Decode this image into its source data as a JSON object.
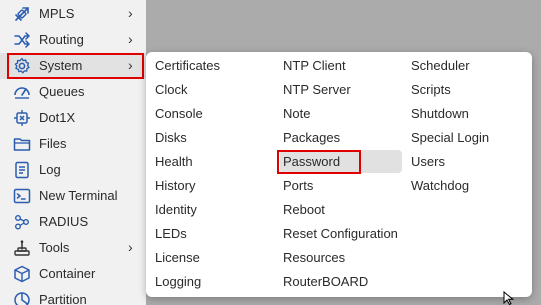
{
  "sidebar": {
    "items": [
      {
        "label": "MPLS",
        "icon": "mpls-icon",
        "has_submenu": true
      },
      {
        "label": "Routing",
        "icon": "routing-icon",
        "has_submenu": true
      },
      {
        "label": "System",
        "icon": "gear-icon",
        "has_submenu": true,
        "active": true
      },
      {
        "label": "Queues",
        "icon": "queues-icon",
        "has_submenu": false
      },
      {
        "label": "Dot1X",
        "icon": "dot1x-icon",
        "has_submenu": false
      },
      {
        "label": "Files",
        "icon": "folder-icon",
        "has_submenu": false
      },
      {
        "label": "Log",
        "icon": "log-icon",
        "has_submenu": false
      },
      {
        "label": "New Terminal",
        "icon": "terminal-icon",
        "has_submenu": false
      },
      {
        "label": "RADIUS",
        "icon": "radius-icon",
        "has_submenu": false
      },
      {
        "label": "Tools",
        "icon": "tools-icon",
        "has_submenu": true
      },
      {
        "label": "Container",
        "icon": "container-icon",
        "has_submenu": false
      },
      {
        "label": "Partition",
        "icon": "partition-icon",
        "has_submenu": false
      }
    ],
    "chevron": "›"
  },
  "submenu": {
    "columns": [
      [
        "Certificates",
        "Clock",
        "Console",
        "Disks",
        "Health",
        "History",
        "Identity",
        "LEDs",
        "License",
        "Logging"
      ],
      [
        "NTP Client",
        "NTP Server",
        "Note",
        "Packages",
        "Password",
        "Ports",
        "Reboot",
        "Reset Configuration",
        "Resources",
        "RouterBOARD"
      ],
      [
        "Scheduler",
        "Scripts",
        "Shutdown",
        "Special Login",
        "Users",
        "Watchdog"
      ]
    ],
    "hovered_item": "Password"
  },
  "colors": {
    "highlight_border": "#e00000",
    "sidebar_bg": "#f1f1f1",
    "icon_blue": "#2a5db0",
    "backdrop": "#ababab"
  }
}
